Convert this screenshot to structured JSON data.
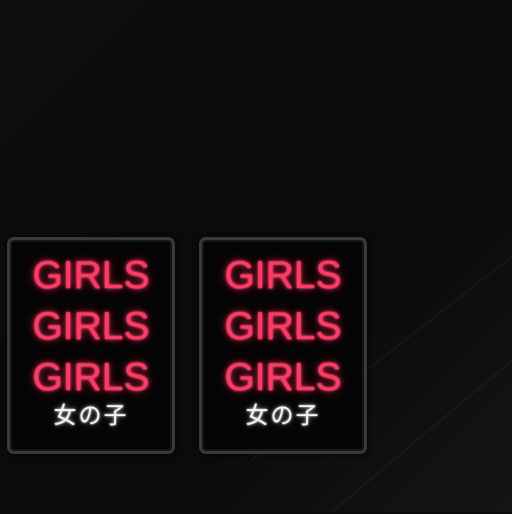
{
  "signs": [
    {
      "lines": [
        "GIRLS",
        "GIRLS",
        "GIRLS"
      ],
      "subtitle": "女の子"
    },
    {
      "lines": [
        "GIRLS",
        "GIRLS",
        "GIRLS"
      ],
      "subtitle": "女の子"
    }
  ],
  "colors": {
    "background": "#0b0b0b",
    "neon_text": "#ff3b64",
    "subtitle_text": "#f4f4f4",
    "frame": "#3a3a3a"
  }
}
